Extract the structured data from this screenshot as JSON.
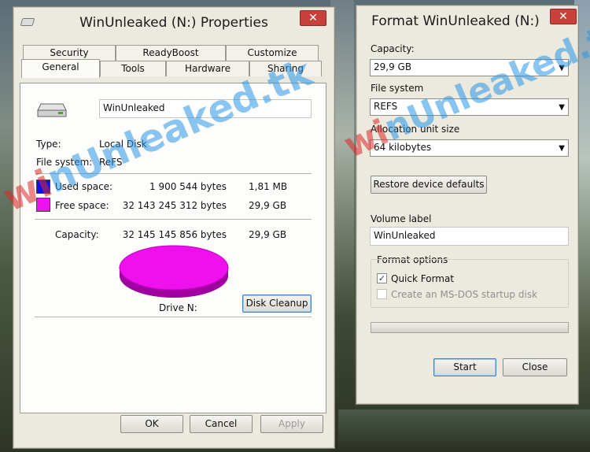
{
  "colors": {
    "used": "#1010ee",
    "free": "#ee11ee"
  },
  "properties": {
    "title": "WinUnleaked (N:) Properties",
    "close_glyph": "✕",
    "tabs_row1": [
      "Security",
      "ReadyBoost",
      "Customize"
    ],
    "tabs_row2": [
      "General",
      "Tools",
      "Hardware",
      "Sharing"
    ],
    "volume_name": "WinUnleaked",
    "type_label": "Type:",
    "type_value": "Local Disk",
    "fs_label": "File system:",
    "fs_value": "ReFS",
    "used_label": "Used space:",
    "used_bytes": "1 900 544 bytes",
    "used_size": "1,81 MB",
    "free_label": "Free space:",
    "free_bytes": "32 143 245 312 bytes",
    "free_size": "29,9 GB",
    "capacity_label": "Capacity:",
    "capacity_bytes": "32 145 145 856 bytes",
    "capacity_size": "29,9 GB",
    "drive_label": "Drive N:",
    "cleanup_label": "Disk Cleanup",
    "ok_label": "OK",
    "cancel_label": "Cancel",
    "apply_label": "Apply"
  },
  "format": {
    "title": "Format WinUnleaked (N:)",
    "close_glyph": "✕",
    "capacity_label": "Capacity:",
    "capacity_value": "29,9 GB",
    "fs_label": "File system",
    "fs_value": "REFS",
    "alloc_label": "Allocation unit size",
    "alloc_value": "64 kilobytes",
    "restore_label": "Restore device defaults",
    "volume_label_caption": "Volume label",
    "volume_label_value": "WinUnleaked",
    "options_label": "Format options",
    "quick_format_label": "Quick Format",
    "quick_format_checked": true,
    "msdos_label": "Create an MS-DOS startup disk",
    "msdos_checked": false,
    "start_label": "Start",
    "close_label": "Close"
  },
  "watermark": {
    "part1": "wi",
    "part2": "nUnleaked.tk"
  }
}
